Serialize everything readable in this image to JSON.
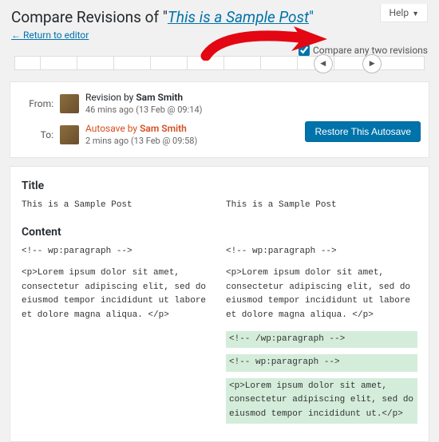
{
  "help_label": "Help",
  "page_title_prefix": "Compare Revisions of \"",
  "post_title": "This is a Sample Post",
  "page_title_suffix": "\"",
  "return_link": "← Return to editor",
  "compare_label": "Compare any two revisions",
  "meta": {
    "from_label": "From:",
    "to_label": "To:",
    "from": {
      "type": "Revision by",
      "author": "Sam Smith",
      "ago": "46 mins ago",
      "date": "(13 Feb @ 09:14)"
    },
    "to": {
      "type": "Autosave by",
      "author": "Sam Smith",
      "ago": "2 mins ago",
      "date": "(13 Feb @ 09:58)"
    }
  },
  "restore_btn": "Restore This Autosave",
  "diff": {
    "title_heading": "Title",
    "content_heading": "Content",
    "title_left": "This is a Sample Post",
    "title_right": "This is a Sample Post",
    "left": [
      "<!-- wp:paragraph -->",
      "<p>Lorem ipsum dolor sit amet, consectetur adipiscing elit, sed do eiusmod tempor incididunt ut labore et dolore magna aliqua. </p>"
    ],
    "right": [
      "<!-- wp:paragraph -->",
      "<p>Lorem ipsum dolor sit amet, consectetur adipiscing elit, sed do eiusmod tempor incididunt ut labore et dolore magna aliqua. </p>"
    ],
    "added": [
      "<!-- /wp:paragraph -->",
      "<!-- wp:paragraph -->",
      "<p>Lorem ipsum dolor sit amet, consectetur adipiscing elit, sed do eiusmod tempor incididunt ut.</p>"
    ]
  }
}
